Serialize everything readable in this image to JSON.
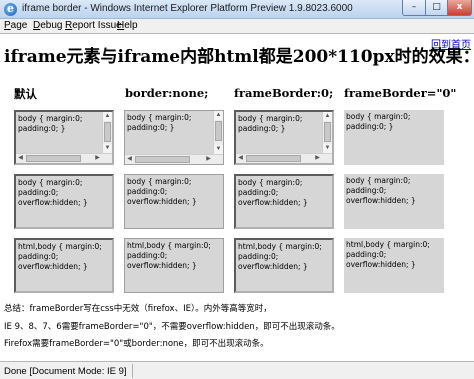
{
  "window": {
    "title": "iframe border - Windows Internet Explorer Platform Preview 1.9.8023.6000",
    "icon_glyph": "e",
    "min_glyph": "–",
    "max_glyph": "□",
    "close_glyph": "x"
  },
  "menu": {
    "page_ul": "P",
    "page_rest": "age",
    "debug_ul": "D",
    "debug_rest": "ebug",
    "report_ul": "R",
    "report_rest": "eport Issue",
    "help_ul": "H",
    "help_rest": "elp"
  },
  "page": {
    "back_link": "回到首页",
    "heading": "iframe元素与iframe内部html都是200*110px时的效果：",
    "columns": [
      "默认",
      "border:none;",
      "frameBorder:0;",
      "frameBorder=\"0\""
    ]
  },
  "frames": {
    "row1_text": "body { margin:0; padding:0; }",
    "row2_text": "body { margin:0; padding:0; overflow:hidden; }",
    "row3_text": "html,body { margin:0; padding:0; overflow:hidden; }"
  },
  "notes": [
    "总结：frameBorder写在css中无效（firefox、IE）。内外等高等宽时，",
    "IE 9、8、7、6需要frameBorder=\"0\"，不需要overflow:hidden，即可不出现滚动条。",
    "Firefox需要frameBorder=\"0\"或border:none，即可不出现滚动条。"
  ],
  "status": {
    "text": "Done [Document Mode: IE 9]"
  },
  "colors": {
    "title_bar": "#bcd3ee",
    "frame_bg": "#d6d6d6",
    "link": "#0000cc"
  }
}
